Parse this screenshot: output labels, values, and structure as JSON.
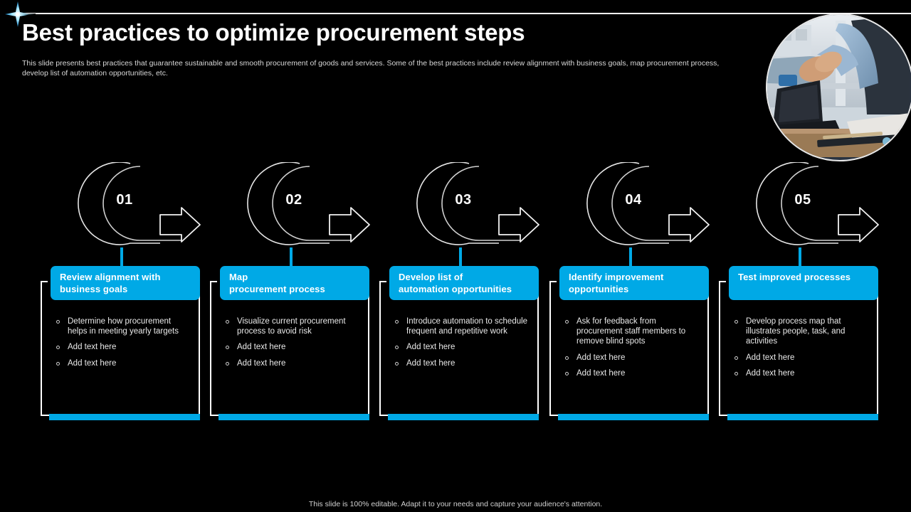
{
  "slide": {
    "title": "Best practices to optimize procurement steps",
    "subtitle": "This slide presents best practices that guarantee sustainable and smooth procurement of goods and services. Some of the best practices include review alignment with business goals, map procurement process, develop list of automation  opportunities, etc.",
    "footer": "This slide is 100% editable.  Adapt it to your needs and capture your audience's attention.",
    "accent_color": "#00A9E6",
    "background_color": "#000000",
    "text_color": "#ffffff"
  },
  "steps": [
    {
      "number": "01",
      "heading_line1": "Review alignment with",
      "heading_line2": "business goals",
      "bullets": [
        "Determine how procurement helps in meeting yearly targets",
        "Add text here",
        "Add text here"
      ]
    },
    {
      "number": "02",
      "heading_line1": "Map",
      "heading_line2": "procurement process",
      "bullets": [
        "Visualize current procurement process to avoid risk",
        "Add text here",
        "Add text here"
      ]
    },
    {
      "number": "03",
      "heading_line1": "Develop list of",
      "heading_line2": "automation opportunities",
      "bullets": [
        "Introduce automation to schedule frequent and repetitive work",
        "Add text here",
        "Add text here"
      ]
    },
    {
      "number": "04",
      "heading_line1": "Identify improvement",
      "heading_line2": "opportunities",
      "bullets": [
        "Ask for feedback from procurement staff members to remove blind spots",
        "Add text here",
        "Add text here"
      ]
    },
    {
      "number": "05",
      "heading_line1": "Test improved processes",
      "heading_line2": "",
      "bullets": [
        "Develop process map that illustrates people, task, and activities",
        "Add text here",
        "Add text here"
      ]
    }
  ],
  "decoration": {
    "sparkle_icon": "sparkle-icon",
    "photo_alt": "business-handshake-photo"
  }
}
